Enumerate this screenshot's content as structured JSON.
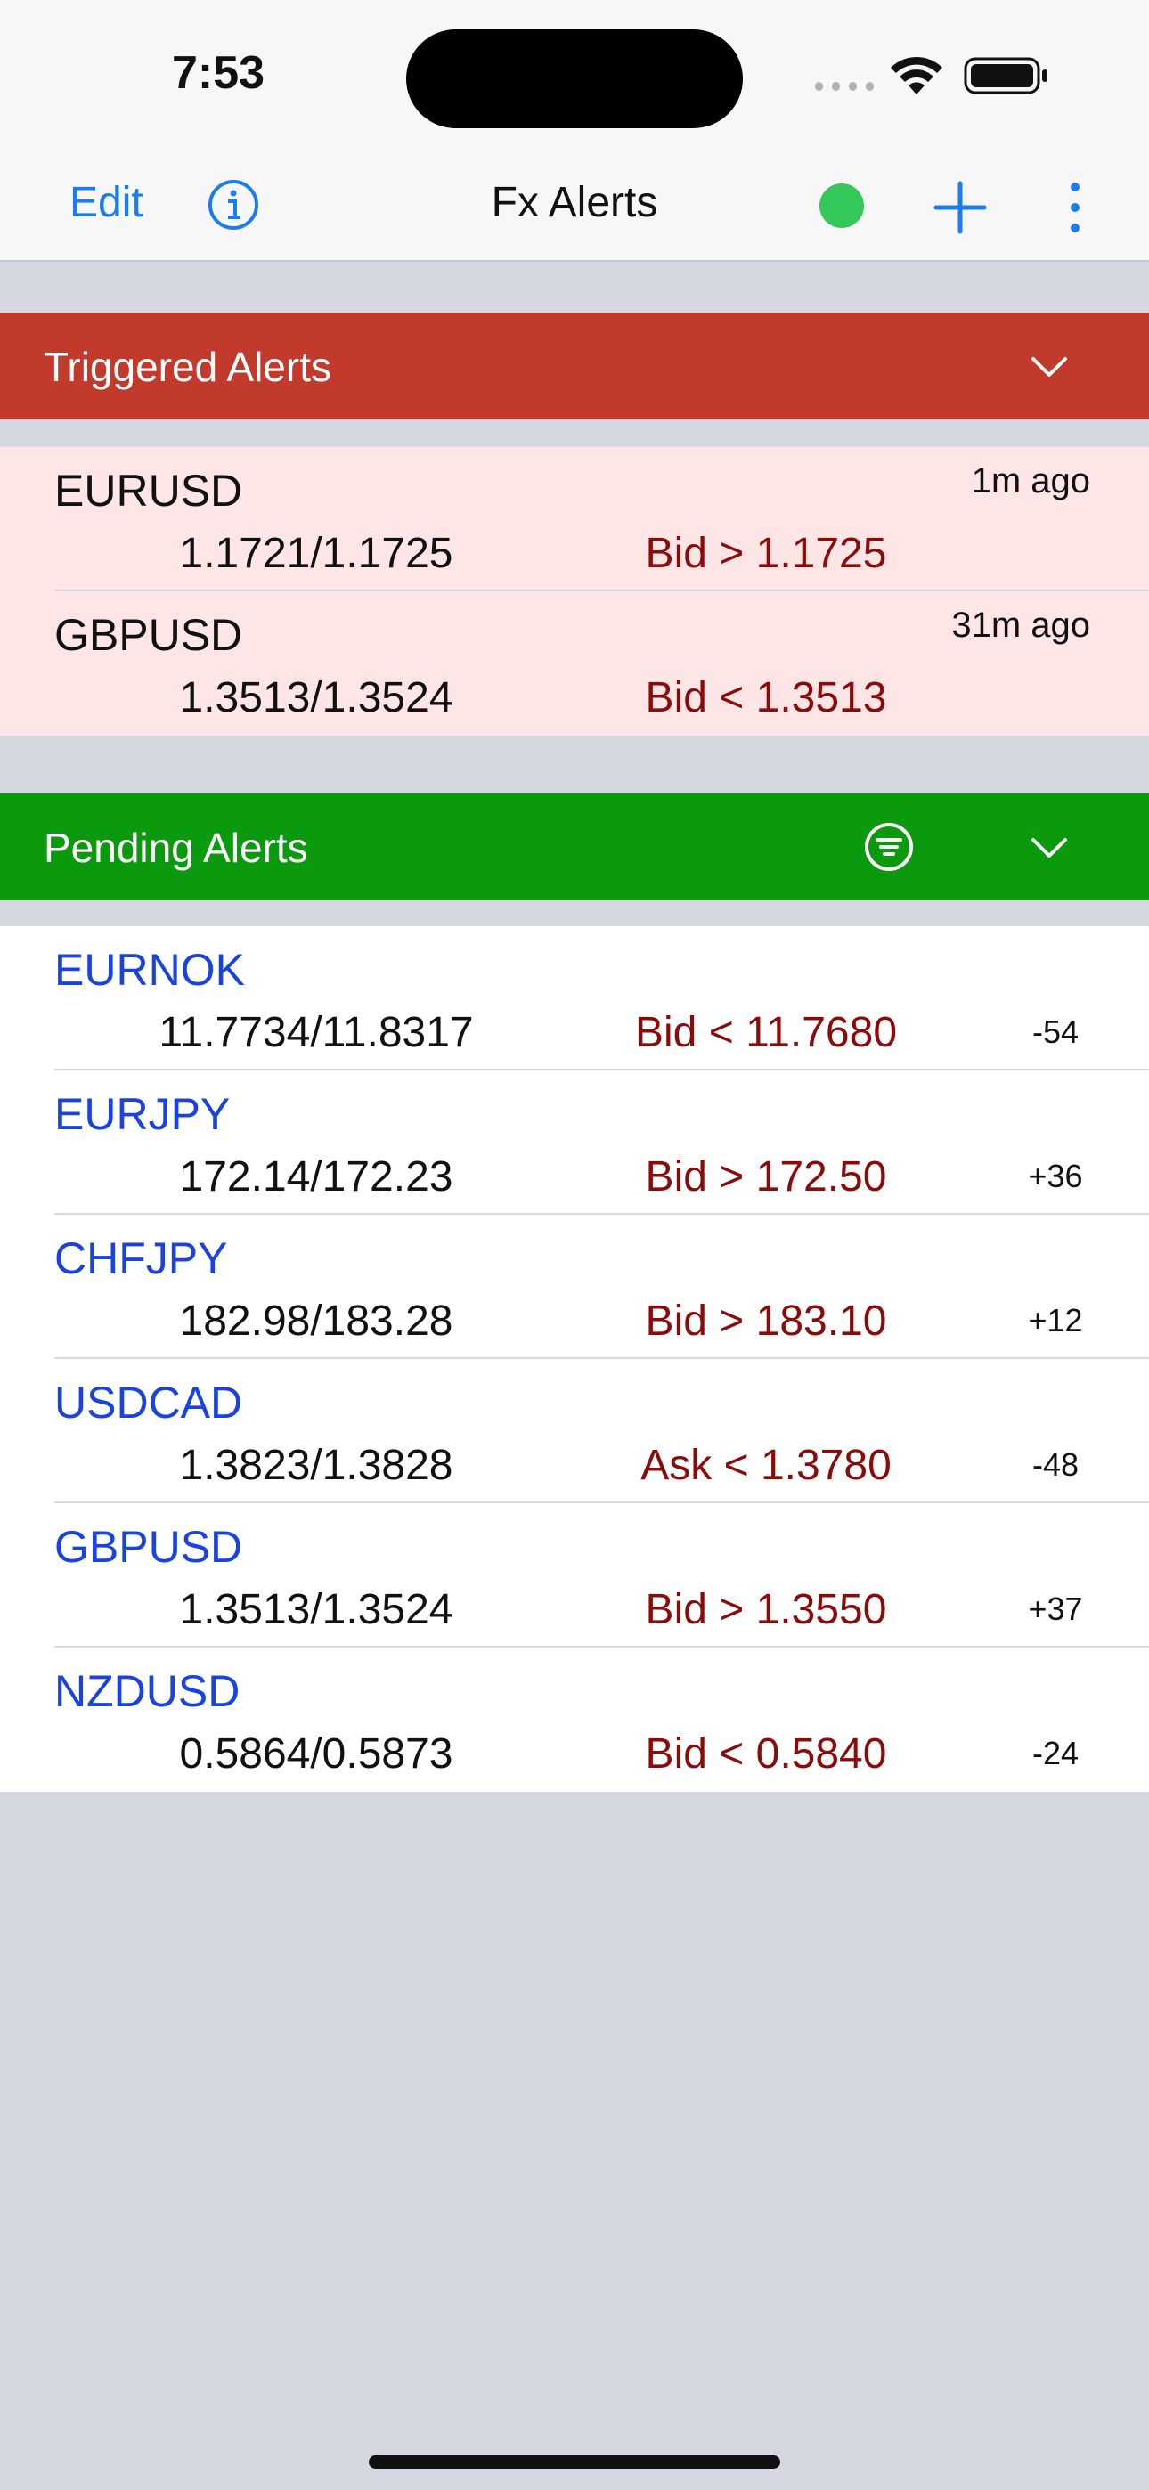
{
  "status": {
    "time": "7:53"
  },
  "nav": {
    "edit_label": "Edit",
    "title": "Fx Alerts",
    "connection_color": "#34c759",
    "icons": [
      "info-icon",
      "add-icon",
      "more-vertical-icon"
    ]
  },
  "triggered": {
    "title": "Triggered Alerts",
    "color": "#c23a2c",
    "rows": [
      {
        "symbol": "EURUSD",
        "quote": "1.1721/1.1725",
        "condition": "Bid > 1.1725",
        "ago": "1m ago"
      },
      {
        "symbol": "GBPUSD",
        "quote": "1.3513/1.3524",
        "condition": "Bid < 1.3513",
        "ago": "31m ago"
      }
    ]
  },
  "pending": {
    "title": "Pending Alerts",
    "color": "#0b9a0d",
    "rows": [
      {
        "symbol": "EURNOK",
        "quote": "11.7734/11.8317",
        "condition": "Bid < 11.7680",
        "pips": "-54"
      },
      {
        "symbol": "EURJPY",
        "quote": "172.14/172.23",
        "condition": "Bid > 172.50",
        "pips": "+36"
      },
      {
        "symbol": "CHFJPY",
        "quote": "182.98/183.28",
        "condition": "Bid > 183.10",
        "pips": "+12"
      },
      {
        "symbol": "USDCAD",
        "quote": "1.3823/1.3828",
        "condition": "Ask < 1.3780",
        "pips": "-48"
      },
      {
        "symbol": "GBPUSD",
        "quote": "1.3513/1.3524",
        "condition": "Bid > 1.3550",
        "pips": "+37"
      },
      {
        "symbol": "NZDUSD",
        "quote": "0.5864/0.5873",
        "condition": "Bid < 0.5840",
        "pips": "-24"
      }
    ]
  }
}
